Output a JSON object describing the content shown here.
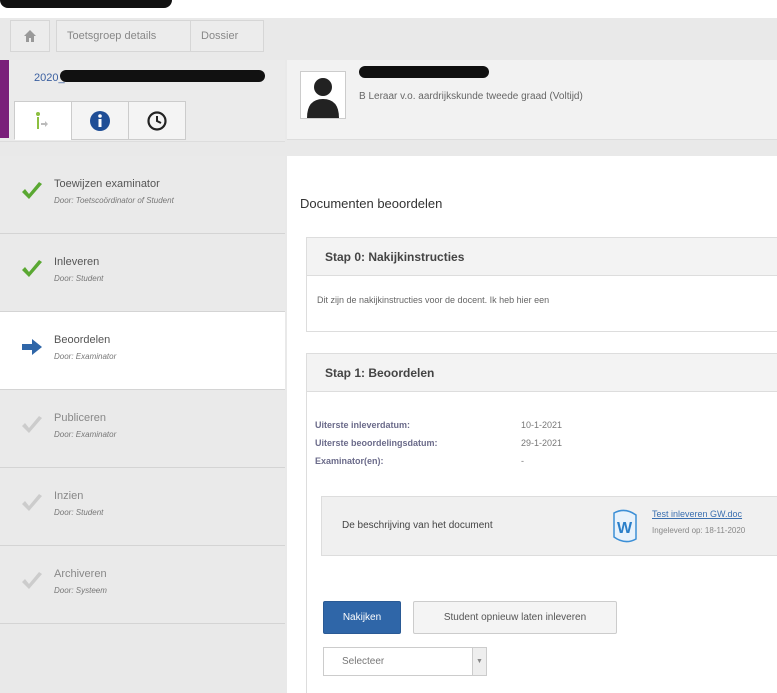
{
  "breadcrumb": {
    "items": [
      "Toetsgroep details",
      "Dossier"
    ]
  },
  "left_header": {
    "code": "2020_"
  },
  "right_header": {
    "subtitle": "B Leraar v.o. aardrijkskunde tweede graad (Voltijd)"
  },
  "steps": [
    {
      "name": "Toewijzen examinator",
      "by_prefix": "Door:",
      "by": "Toetscoördinator of Student",
      "status": "done"
    },
    {
      "name": "Inleveren",
      "by_prefix": "Door:",
      "by": "Student",
      "status": "done"
    },
    {
      "name": "Beoordelen",
      "by_prefix": "Door:",
      "by": "Examinator",
      "status": "current"
    },
    {
      "name": "Publiceren",
      "by_prefix": "Door:",
      "by": "Examinator",
      "status": "pending"
    },
    {
      "name": "Inzien",
      "by_prefix": "Door:",
      "by": "Student",
      "status": "pending"
    },
    {
      "name": "Archiveren",
      "by_prefix": "Door:",
      "by": "Systeem",
      "status": "pending"
    }
  ],
  "main": {
    "title": "Documenten beoordelen",
    "step0": {
      "title": "Stap 0: Nakijkinstructies",
      "text": "Dit zijn de nakijkinstructies voor de docent. Ik heb hier een"
    },
    "step1": {
      "title": "Stap 1: Beoordelen",
      "rows": [
        {
          "label": "Uiterste inleverdatum:",
          "value": "10-1-2021"
        },
        {
          "label": "Uiterste beoordelingsdatum:",
          "value": "29-1-2021"
        },
        {
          "label": "Examinator(en):",
          "value": "-"
        }
      ],
      "doc_description": "De beschrijving van het document",
      "doc_link": "Test inleveren GW.doc",
      "doc_meta": "Ingeleverd op: 18-11-2020",
      "btn_primary": "Nakijken",
      "btn_secondary": "Student opnieuw laten inleveren",
      "select_value": "Selecteer"
    }
  },
  "colors": {
    "accent": "#7a1f7a",
    "primary": "#2f66a8",
    "check": "#5aa832",
    "arrow": "#2f66a8"
  }
}
